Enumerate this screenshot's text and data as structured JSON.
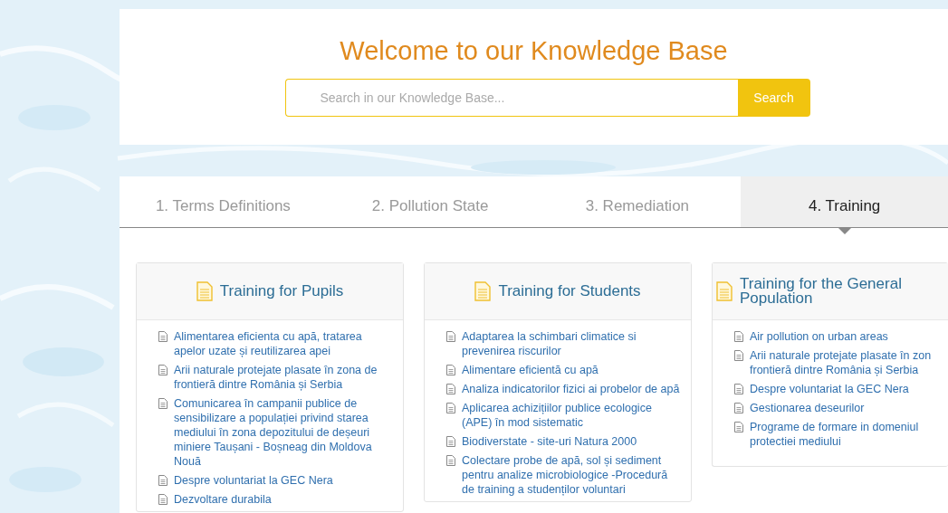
{
  "header": {
    "title": "Welcome to our Knowledge Base",
    "search": {
      "placeholder": "Search in our Knowledge Base..."
    },
    "search_button": "Search"
  },
  "tabs": [
    {
      "label": "1. Terms Definitions",
      "selected": false
    },
    {
      "label": "2. Pollution State",
      "selected": false
    },
    {
      "label": "3. Remediation",
      "selected": false
    },
    {
      "label": "4. Training",
      "selected": true
    }
  ],
  "cards": [
    {
      "title": "Training for Pupils",
      "items": [
        "Alimentarea eficienta cu apă, tratarea apelor uzate și reutilizarea apei",
        "Arii naturale protejate plasate în zona de frontieră dintre România și Serbia",
        "Comunicarea în campanii publice de sensibilizare a populației privind starea mediului în zona depozitului de deșeuri miniere Taușani - Boșneag din Moldova Nouă",
        "Despre voluntariat la GEC Nera",
        "Dezvoltare durabila"
      ]
    },
    {
      "title": "Training for Students",
      "items": [
        "Adaptarea la schimbari climatice si prevenirea riscurilor",
        "Alimentare eficientă cu apă",
        "Analiza indicatorilor fizici ai probelor de apă",
        "Aplicarea achizițiilor publice ecologice (APE) în mod sistematic",
        "Biodiverstate - site-uri Natura 2000",
        "Colectare probe de apă, sol și sediment pentru analize microbiologice -Procedură de training a studenților voluntari"
      ]
    },
    {
      "title": "Training for the General Population",
      "items": [
        "Air pollution on urban areas",
        "Arii naturale protejate plasate în zon\nfrontieră dintre România și Serbia",
        "Despre voluntariat la GEC Nera",
        "Gestionarea deseurilor",
        "Programe de formare in domeniul protectiei mediului"
      ]
    }
  ]
}
